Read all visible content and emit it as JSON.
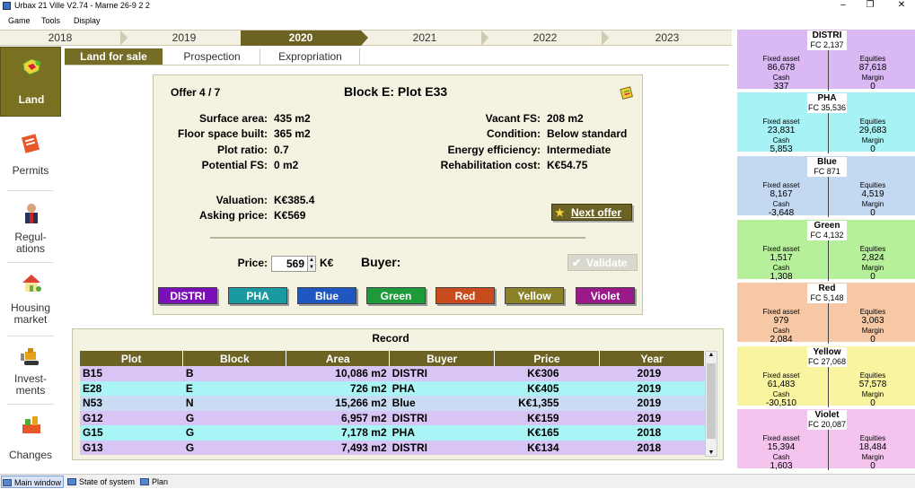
{
  "window": {
    "title": "Urbax 21 Ville V2.74 - Marne 26-9 2 2",
    "minimize": "–",
    "maximize": "❐",
    "close": "✕"
  },
  "menu": [
    "Game",
    "Tools",
    "Display"
  ],
  "years": [
    "2018",
    "2019",
    "2020",
    "2021",
    "2022",
    "2023"
  ],
  "selected_year": "2020",
  "sidebar": [
    {
      "label": "Land",
      "icon": "land-icon"
    },
    {
      "label": "Permits",
      "icon": "permits-icon"
    },
    {
      "label": "Regul-",
      "label2": "ations",
      "icon": "regulations-icon"
    },
    {
      "label": "Housing",
      "label2": "market",
      "icon": "housing-icon"
    },
    {
      "label": "Invest-",
      "label2": "ments",
      "icon": "bulldozer-icon"
    },
    {
      "label": "Changes",
      "icon": "changes-icon"
    }
  ],
  "tabs": [
    "Land for sale",
    "Prospection",
    "Expropriation"
  ],
  "offer": {
    "counter": "Offer 4 / 7",
    "title": "Block E: Plot E33",
    "surface_area_label": "Surface area:",
    "surface_area": "435 m2",
    "floor_space_label": "Floor space built:",
    "floor_space": "365 m2",
    "plot_ratio_label": "Plot ratio:",
    "plot_ratio": "0.7",
    "potential_fs_label": "Potential FS:",
    "potential_fs": "0 m2",
    "vacant_fs_label": "Vacant FS:",
    "vacant_fs": "208 m2",
    "condition_label": "Condition:",
    "condition": "Below standard",
    "energy_label": "Energy efficiency:",
    "energy": "Intermediate",
    "rehab_label": "Rehabilitation cost:",
    "rehab": "K€54.75",
    "valuation_label": "Valuation:",
    "valuation": "K€385.4",
    "asking_label": "Asking price:",
    "asking": "K€569",
    "next_offer": "Next offer",
    "price_label": "Price:",
    "price_value": "569",
    "price_unit": "K€",
    "buyer_label": "Buyer:",
    "validate": "Validate",
    "buyers": [
      {
        "name": "DISTRI",
        "color": "#7b10b8"
      },
      {
        "name": "PHA",
        "color": "#1a9aa0"
      },
      {
        "name": "Blue",
        "color": "#1f57c0"
      },
      {
        "name": "Green",
        "color": "#1d9a3a"
      },
      {
        "name": "Red",
        "color": "#c84b1d"
      },
      {
        "name": "Yellow",
        "color": "#8a8128"
      },
      {
        "name": "Violet",
        "color": "#9a1a8a"
      }
    ]
  },
  "record": {
    "title": "Record",
    "columns": [
      "Plot",
      "Block",
      "Area",
      "Buyer",
      "Price",
      "Year"
    ],
    "rows": [
      {
        "plot": "B15",
        "block": "B",
        "area": "10,086 m2",
        "buyer": "DISTRI",
        "price": "K€306",
        "year": "2019",
        "style": "purple"
      },
      {
        "plot": "E28",
        "block": "E",
        "area": "726 m2",
        "buyer": "PHA",
        "price": "K€405",
        "year": "2019",
        "style": "cyan"
      },
      {
        "plot": "N53",
        "block": "N",
        "area": "15,266 m2",
        "buyer": "Blue",
        "price": "K€1,355",
        "year": "2019",
        "style": "blue"
      },
      {
        "plot": "G12",
        "block": "G",
        "area": "6,957 m2",
        "buyer": "DISTRI",
        "price": "K€159",
        "year": "2019",
        "style": "purple"
      },
      {
        "plot": "G15",
        "block": "G",
        "area": "7,178 m2",
        "buyer": "PHA",
        "price": "K€165",
        "year": "2018",
        "style": "cyan"
      },
      {
        "plot": "G13",
        "block": "G",
        "area": "7,493 m2",
        "buyer": "DISTRI",
        "price": "K€134",
        "year": "2018",
        "style": "purple"
      }
    ]
  },
  "companies_labels": {
    "fixed_asset": "Fixed asset",
    "equities": "Equities",
    "cash": "Cash",
    "margin": "Margin"
  },
  "companies": [
    {
      "name": "DISTRI",
      "fc": "FC 2,137",
      "fixed_asset": "86,678",
      "equities": "87,618",
      "cash": "337",
      "margin": "0",
      "color": "#d9b8f4"
    },
    {
      "name": "PHA",
      "fc": "FC 35,536",
      "fixed_asset": "23,831",
      "equities": "29,683",
      "cash": "5,853",
      "margin": "0",
      "color": "#a6f2f5"
    },
    {
      "name": "Blue",
      "fc": "FC 871",
      "fixed_asset": "8,167",
      "equities": "4,519",
      "cash": "-3,648",
      "margin": "0",
      "color": "#c3d9f2"
    },
    {
      "name": "Green",
      "fc": "FC 4,132",
      "fixed_asset": "1,517",
      "equities": "2,824",
      "cash": "1,308",
      "margin": "0",
      "color": "#b7f09a"
    },
    {
      "name": "Red",
      "fc": "FC 5,148",
      "fixed_asset": "979",
      "equities": "3,063",
      "cash": "2,084",
      "margin": "0",
      "color": "#f7c8a6"
    },
    {
      "name": "Yellow",
      "fc": "FC 27,068",
      "fixed_asset": "61,483",
      "equities": "57,578",
      "cash": "-30,510",
      "margin": "0",
      "color": "#f9f4a0"
    },
    {
      "name": "Violet",
      "fc": "FC 20,087",
      "fixed_asset": "15,394",
      "equities": "18,484",
      "cash": "1,603",
      "margin": "0",
      "color": "#f4c4ee"
    }
  ],
  "statusbar": [
    "Main window",
    "State of system",
    "Plan"
  ]
}
